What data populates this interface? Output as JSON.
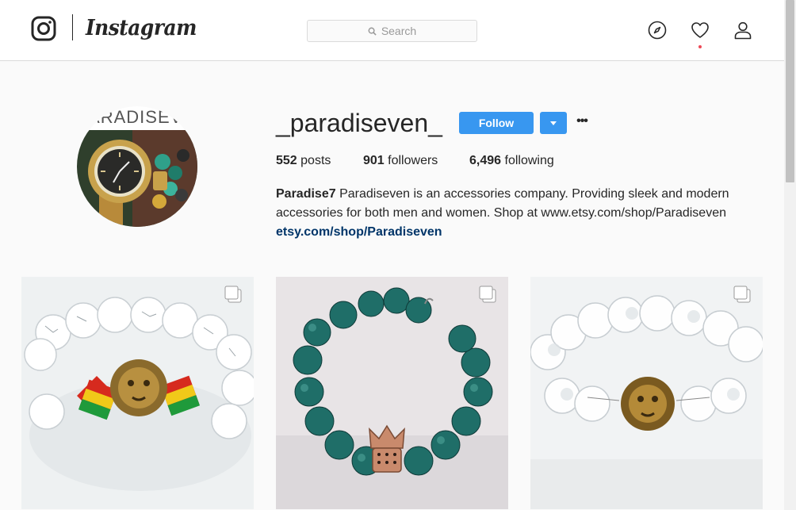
{
  "app": {
    "brand": "Instagram",
    "accent": "#3897f0",
    "link_color": "#003569",
    "notification_dot": "#ed4956"
  },
  "header": {
    "search_placeholder": "Search",
    "icons": [
      "instagram-glyph-icon",
      "search-icon",
      "explore-compass-icon",
      "heart-icon",
      "person-icon"
    ]
  },
  "profile": {
    "avatar_text": "PARADISEVEN",
    "username": "_paradiseven_",
    "follow_label": "Follow",
    "more_label": "•••",
    "stats": {
      "posts_count": "552",
      "posts_label": "posts",
      "followers_count": "901",
      "followers_label": "followers",
      "following_count": "6,496",
      "following_label": "following"
    },
    "full_name": "Paradise7",
    "bio": "Paradiseven is an accessories company. Providing sleek and modern accessories for both men and women. Shop at www.etsy.com/shop/Paradiseven",
    "website": "etsy.com/shop/Paradiseven"
  },
  "posts": [
    {
      "subject": "white marble bead bracelet with rasta stripes and gold lion head",
      "multiple": true
    },
    {
      "subject": "teal bead bracelet with rose gold crown charm",
      "multiple": true
    },
    {
      "subject": "clear frosted bead bracelet with gold lion head",
      "multiple": true
    }
  ]
}
